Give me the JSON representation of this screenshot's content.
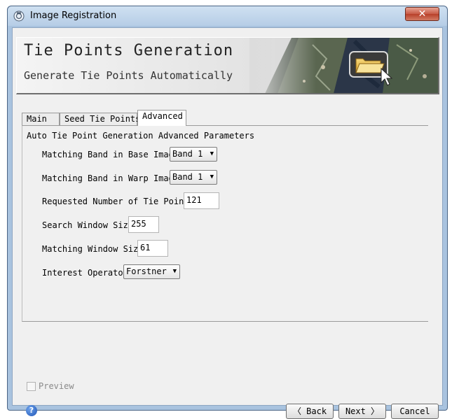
{
  "window": {
    "title": "Image Registration",
    "close_label": "✕"
  },
  "banner": {
    "title": "Tie Points Generation",
    "subtitle": "Generate Tie Points Automatically"
  },
  "tabs": [
    {
      "label": "Main",
      "active": false
    },
    {
      "label": "Seed Tie Points",
      "active": false
    },
    {
      "label": "Advanced",
      "active": true
    }
  ],
  "advanced": {
    "section_title": "Auto Tie Point Generation Advanced Parameters",
    "base_band": {
      "label": "Matching Band in Base Image",
      "value": "Band 1"
    },
    "warp_band": {
      "label": "Matching Band in Warp Image",
      "value": "Band 1"
    },
    "num_tie_points": {
      "label": "Requested Number of Tie Points",
      "value": "121"
    },
    "search_window": {
      "label": "Search Window Size",
      "value": "255"
    },
    "matching_window": {
      "label": "Matching Window Size",
      "value": "61"
    },
    "interest_operator": {
      "label": "Interest Operator",
      "value": "Forstner"
    }
  },
  "preview": {
    "label": "Preview",
    "checked": false,
    "enabled": false
  },
  "help_icon": "question-mark-icon",
  "buttons": {
    "back": "〈 Back",
    "next": "Next 〉",
    "cancel": "Cancel"
  },
  "colors": {
    "title_bar": "#b6cde6",
    "close_button": "#c75a45",
    "background": "#f0f0f0"
  }
}
